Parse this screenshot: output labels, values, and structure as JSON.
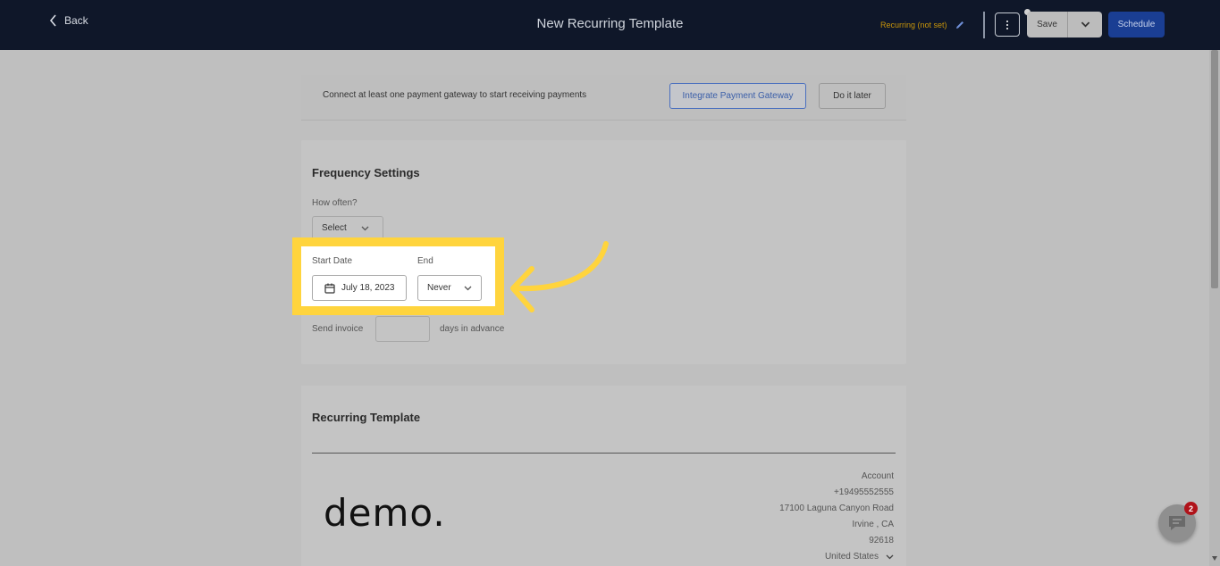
{
  "header": {
    "back_label": "Back",
    "title": "New Recurring Template",
    "recurring_status": "Recurring (not set)",
    "save_label": "Save",
    "schedule_label": "Schedule"
  },
  "banner": {
    "text": "Connect at least one payment gateway to start receiving payments",
    "integrate_label": "Integrate Payment Gateway",
    "later_label": "Do it later"
  },
  "frequency": {
    "title": "Frequency Settings",
    "how_often_label": "How often?",
    "how_often_value": "Select",
    "start_date_label": "Start Date",
    "start_date_value": "July 18, 2023",
    "end_label": "End",
    "end_value": "Never",
    "send_invoice_label": "Send invoice",
    "days_in_advance_label": "days in advance"
  },
  "template": {
    "title": "Recurring Template",
    "logo_text": "demo.",
    "address_lines": [
      "Account",
      "+19495552555",
      "17100 Laguna Canyon Road",
      "Irvine , CA",
      "92618",
      "United States"
    ]
  },
  "chat": {
    "badge_count": "2"
  },
  "colors": {
    "highlight": "#ffd43d",
    "header_bg": "#0f1729",
    "schedule_bg": "#1a3e93",
    "recurring_status": "#c8950a"
  }
}
